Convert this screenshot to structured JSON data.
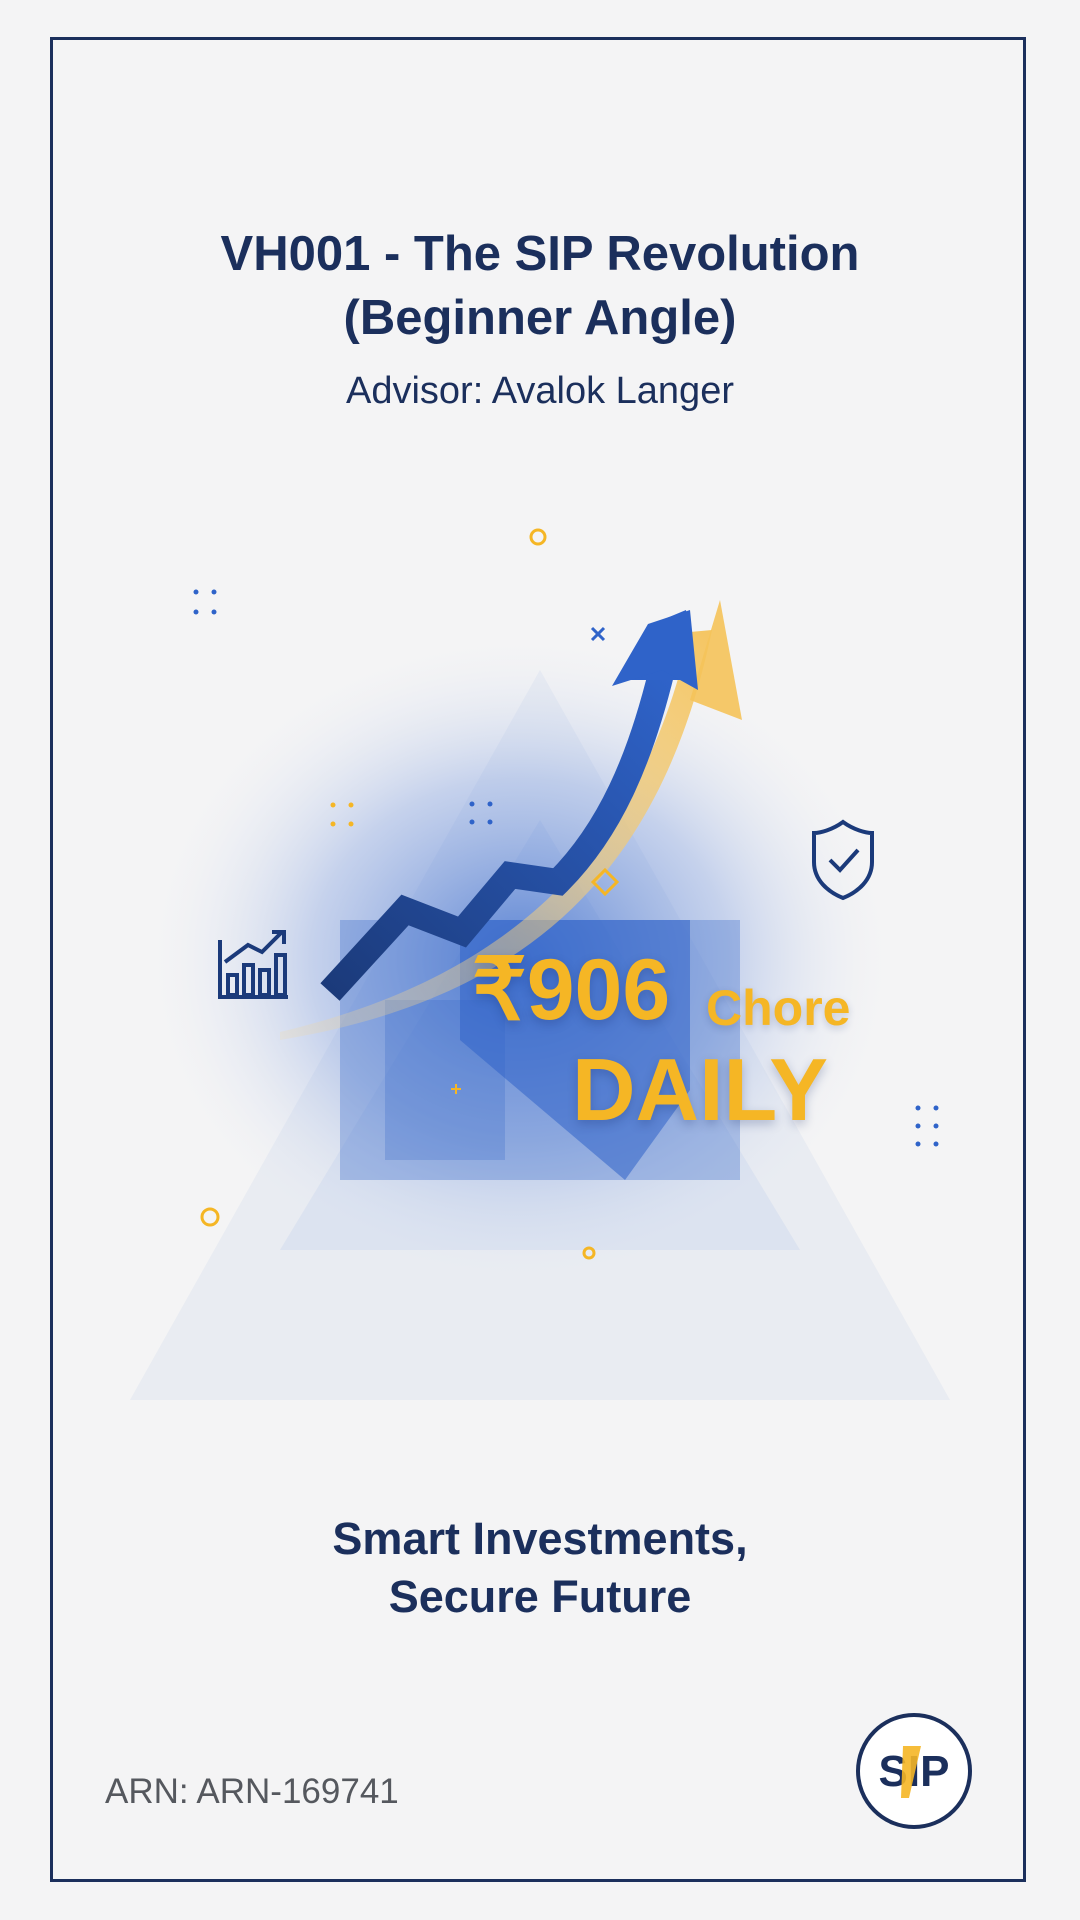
{
  "header": {
    "title_line1": "VH001 - The SIP Revolution",
    "title_line2": "(Beginner Angle)",
    "advisor": "Advisor: Avalok Langer"
  },
  "hero": {
    "amount": "₹906",
    "amount_unit": "Chore",
    "frequency": "DAILY",
    "icons": [
      "growth-arrow-icon",
      "bar-chart-icon",
      "shield-check-icon",
      "sparkle-icon",
      "diamond-icon",
      "dot-grid-icon"
    ]
  },
  "tagline": {
    "line1": "Smart Investments,",
    "line2": "Secure Future"
  },
  "footer": {
    "arn": "ARN: ARN-169741",
    "logo_text": "SIP"
  },
  "colors": {
    "navy": "#1b2f5c",
    "accent_gold": "#f5b625",
    "accent_blue": "#2f63c9"
  }
}
